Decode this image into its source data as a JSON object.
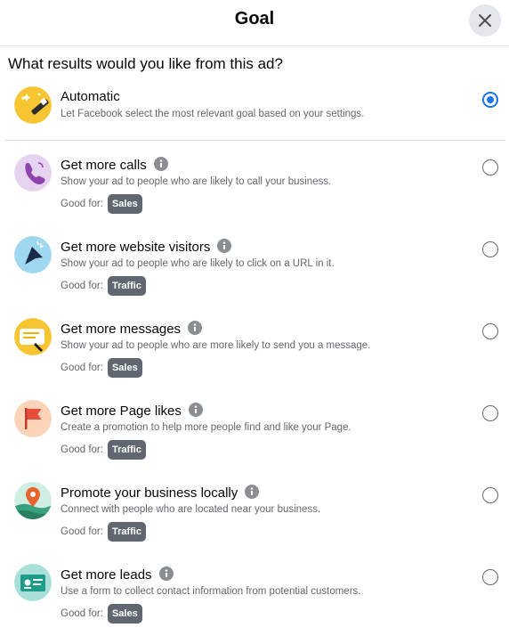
{
  "dialog": {
    "title": "Goal",
    "question": "What results would you like from this ad?",
    "good_for_label": "Good for:"
  },
  "colors": {
    "accent": "#1877f2",
    "badge_bg": "#606770"
  },
  "options": [
    {
      "title": "Automatic",
      "description": "Let Facebook select the most relevant goal based on your settings.",
      "icon": "magic-wand-icon",
      "selected": true
    },
    {
      "title": "Get more calls",
      "description": "Show your ad to people who are likely to call your business.",
      "good_for": "Sales",
      "icon": "phone-icon",
      "selected": false
    },
    {
      "title": "Get more website visitors",
      "description": "Show your ad to people who are likely to click on a URL in it.",
      "good_for": "Traffic",
      "icon": "cursor-icon",
      "selected": false
    },
    {
      "title": "Get more messages",
      "description": "Show your ad to people who are more likely to send you a message.",
      "good_for": "Sales",
      "icon": "message-icon",
      "selected": false
    },
    {
      "title": "Get more Page likes",
      "description": "Create a promotion to help more people find and like your Page.",
      "good_for": "Traffic",
      "icon": "flag-icon",
      "selected": false
    },
    {
      "title": "Promote your business locally",
      "description": "Connect with people who are located near your business.",
      "good_for": "Traffic",
      "icon": "location-pin-icon",
      "selected": false
    },
    {
      "title": "Get more leads",
      "description": "Use a form to collect contact information from potential customers.",
      "good_for": "Sales",
      "icon": "contact-card-icon",
      "selected": false
    }
  ]
}
